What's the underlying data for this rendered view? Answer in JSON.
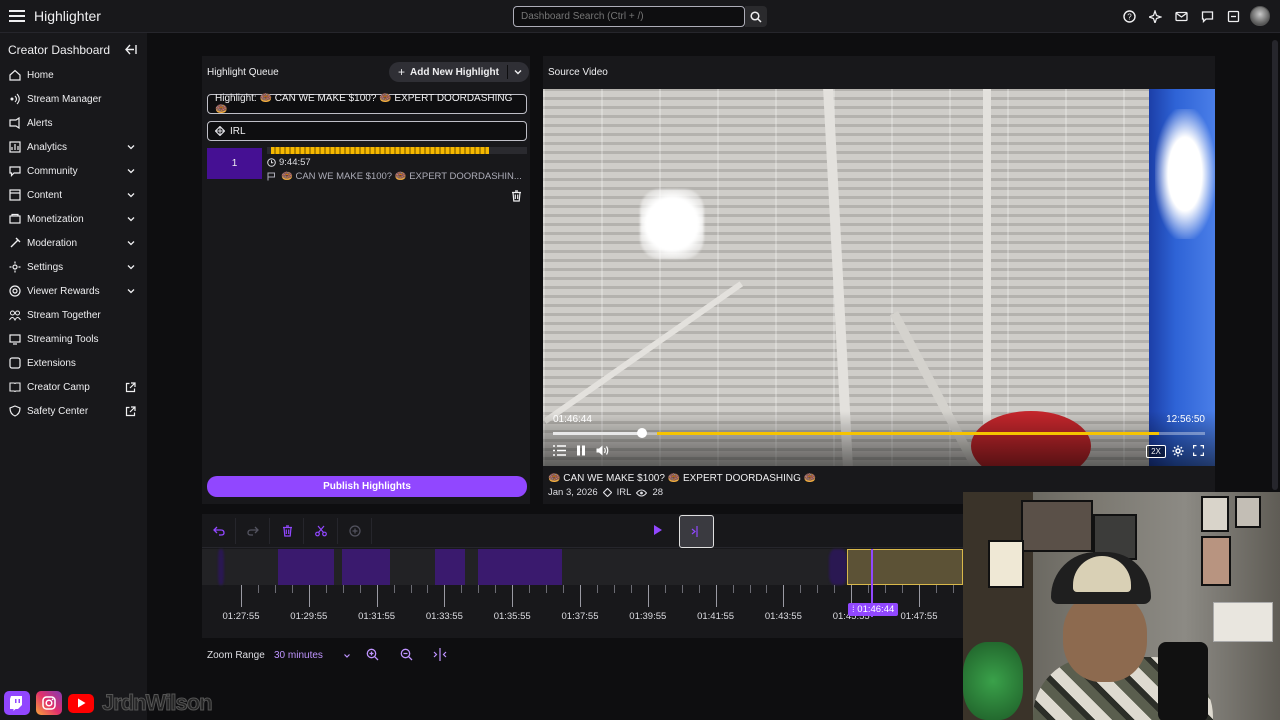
{
  "app": {
    "title": "Highlighter"
  },
  "search": {
    "placeholder": "Dashboard Search (Ctrl + /)"
  },
  "sidebar": {
    "header": "Creator Dashboard",
    "items": [
      {
        "label": "Home",
        "icon": "home-icon",
        "expandable": false,
        "external": false
      },
      {
        "label": "Stream Manager",
        "icon": "stream-manager-icon",
        "expandable": false,
        "external": false
      },
      {
        "label": "Alerts",
        "icon": "alerts-icon",
        "expandable": false,
        "external": false
      },
      {
        "label": "Analytics",
        "icon": "analytics-icon",
        "expandable": true,
        "external": false
      },
      {
        "label": "Community",
        "icon": "community-icon",
        "expandable": true,
        "external": false
      },
      {
        "label": "Content",
        "icon": "content-icon",
        "expandable": true,
        "external": false
      },
      {
        "label": "Monetization",
        "icon": "monetization-icon",
        "expandable": true,
        "external": false
      },
      {
        "label": "Moderation",
        "icon": "moderation-icon",
        "expandable": true,
        "external": false
      },
      {
        "label": "Settings",
        "icon": "settings-icon",
        "expandable": true,
        "external": false
      },
      {
        "label": "Viewer Rewards",
        "icon": "viewer-rewards-icon",
        "expandable": true,
        "external": false
      },
      {
        "label": "Stream Together",
        "icon": "stream-together-icon",
        "expandable": false,
        "external": false
      },
      {
        "label": "Streaming Tools",
        "icon": "streaming-tools-icon",
        "expandable": false,
        "external": false
      },
      {
        "label": "Extensions",
        "icon": "extensions-icon",
        "expandable": false,
        "external": false
      },
      {
        "label": "Creator Camp",
        "icon": "creator-camp-icon",
        "expandable": false,
        "external": true
      },
      {
        "label": "Safety Center",
        "icon": "safety-center-icon",
        "expandable": false,
        "external": true
      }
    ]
  },
  "queue": {
    "title": "Highlight Queue",
    "add_label": "Add New Highlight",
    "highlight_title": "Highlight: 🍩 CAN WE MAKE $100? 🍩 EXPERT DOORDASHING 🍩",
    "category": "IRL",
    "card": {
      "number": "1",
      "duration": "9:44:57",
      "name": "🍩 CAN WE MAKE $100? 🍩 EXPERT DOORDASHIN..."
    },
    "publish_label": "Publish Highlights"
  },
  "source": {
    "title": "Source Video",
    "current_time": "01:46:44",
    "total_time": "12:56:50",
    "speed": "2X",
    "progress": 0.137,
    "video_title": "🍩 CAN WE MAKE $100? 🍩 EXPERT DOORDASHING 🍩",
    "date": "Jan 3, 2026",
    "category": "IRL",
    "views": "28"
  },
  "timeline": {
    "tick_labels": [
      "01:27:55",
      "01:29:55",
      "01:31:55",
      "01:33:55",
      "01:35:55",
      "01:37:55",
      "01:39:55",
      "01:41:55",
      "01:43:55",
      "01:45:55",
      "01:47:55"
    ],
    "cursor_label": "01:46:44",
    "zoom_label": "Zoom Range",
    "zoom_value": "30 minutes"
  },
  "colors": {
    "accent": "#9147ff",
    "highlight": "#f6b800"
  }
}
